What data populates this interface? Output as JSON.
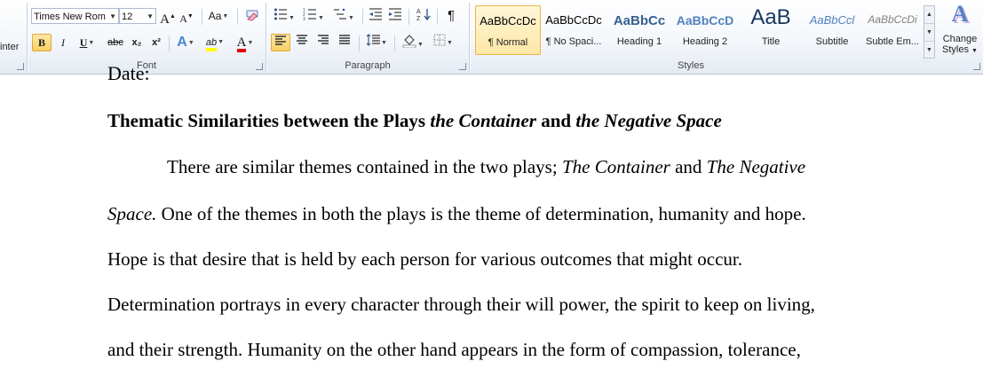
{
  "clipboard": {
    "format_painter_partial": "inter"
  },
  "font": {
    "group_label": "Font",
    "font_name": "Times New Rom",
    "font_size": "12",
    "grow_label": "A",
    "shrink_label": "A",
    "change_case_label": "Aa",
    "bold_label": "B",
    "italic_label": "I",
    "underline_label": "U",
    "strike_label": "abc",
    "subscript_label": "x₂",
    "superscript_label": "x²",
    "text_effects_label": "A",
    "highlight_label": "ab",
    "font_color_label": "A"
  },
  "paragraph": {
    "group_label": "Paragraph",
    "pilcrow_label": "¶"
  },
  "styles": {
    "group_label": "Styles",
    "items": [
      {
        "preview": "AaBbCcDc",
        "name": "¶ Normal",
        "selected": true
      },
      {
        "preview": "AaBbCcDc",
        "name": "¶ No Spaci..."
      },
      {
        "preview": "AaBbCc",
        "name": "Heading 1"
      },
      {
        "preview": "AaBbCcD",
        "name": "Heading 2"
      },
      {
        "preview": "AaB",
        "name": "Title"
      },
      {
        "preview": "AaBbCcl",
        "name": "Subtitle"
      },
      {
        "preview": "AaBbCcDi",
        "name": "Subtle Em..."
      }
    ],
    "change_styles_icon_label": "A",
    "change_styles_line1": "Change",
    "change_styles_line2": "Styles"
  },
  "colors": {
    "heading_blue": "#365f91",
    "font_red": "#e00000",
    "highlight_yellow": "#ffff00",
    "selected_gold": "#e8b34c"
  },
  "document": {
    "partial_top": "Date:",
    "title_part1": "Thematic Similarities between the Plays ",
    "title_italic1": "the Container",
    "title_part2": " and ",
    "title_italic2": "the Negative Space",
    "p1_text": "There are similar themes contained in the two plays; ",
    "p1_italic1": "The Container",
    "p1_mid": " and ",
    "p1_italic2": "The Negative",
    "p2_italic": "Space.",
    "p2_text": " One of the themes in both the plays is the theme of determination, humanity and hope.",
    "p3_text": "Hope is that desire that is held by each person for various outcomes that might occur.",
    "p4_text": "Determination portrays in every character through their will power, the spirit to keep on living,",
    "p5_text": "and their strength. Humanity on the other hand appears in the form of compassion, tolerance,"
  }
}
